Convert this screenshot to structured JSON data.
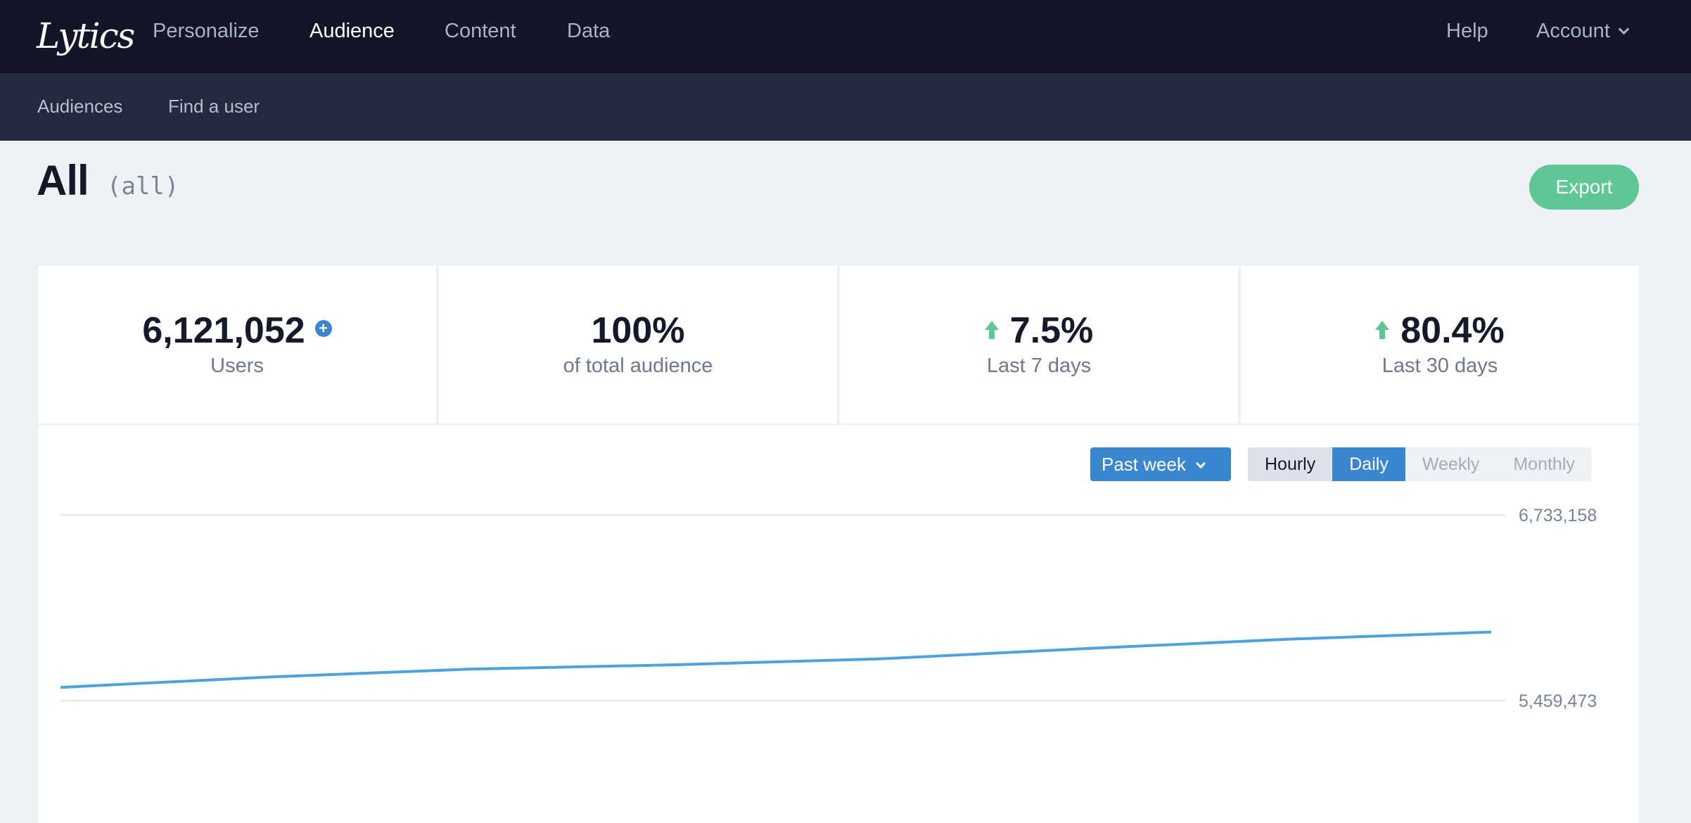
{
  "topnav": {
    "logo": "Lytics",
    "links": [
      "Personalize",
      "Audience",
      "Content",
      "Data"
    ],
    "active": "Audience",
    "help": "Help",
    "account": "Account"
  },
  "subnav": {
    "links": [
      "Audiences",
      "Find a user"
    ]
  },
  "page": {
    "title": "All",
    "slug": "(all)",
    "export_label": "Export"
  },
  "stats": [
    {
      "value": "6,121,052",
      "label": "Users",
      "icon": "plus-icon"
    },
    {
      "value": "100%",
      "label": "of total audience",
      "icon": ""
    },
    {
      "value": "7.5%",
      "label": "Last 7 days",
      "icon": "up-arrow-icon"
    },
    {
      "value": "80.4%",
      "label": "Last 30 days",
      "icon": "up-arrow-icon"
    }
  ],
  "controls": {
    "range_label": "Past week",
    "granularity": [
      "Hourly",
      "Daily",
      "Weekly",
      "Monthly"
    ],
    "selected_granularity": "Daily"
  },
  "chart_data": {
    "type": "line",
    "x": [
      1,
      2,
      3,
      4,
      5,
      6,
      7,
      8
    ],
    "series": [
      {
        "values": [
          5550000,
          5620000,
          5675000,
          5705000,
          5745000,
          5815000,
          5880000,
          5930000
        ]
      }
    ],
    "y_ticks": [
      "6,733,158",
      "5,459,473"
    ],
    "ylim": [
      5459473,
      6733158
    ],
    "color": "#4aa3df",
    "grid": true
  }
}
